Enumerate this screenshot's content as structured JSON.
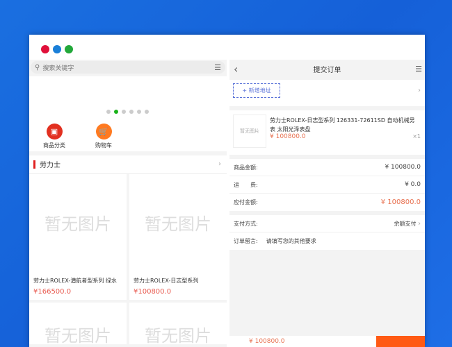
{
  "window": {
    "controls": [
      "close",
      "minimize",
      "maximize"
    ],
    "colors": {
      "close": "#e0103a",
      "minimize": "#1a7fd8",
      "maximize": "#22a83a"
    }
  },
  "left": {
    "search_placeholder": "搜索关键字",
    "banner_dots": 6,
    "banner_active": 1,
    "shortcuts": [
      {
        "label": "商品分类",
        "icon": "bag-icon",
        "color": "#e23020"
      },
      {
        "label": "购物车",
        "icon": "cart-icon",
        "color": "#ff7a20"
      }
    ],
    "section_title": "劳力士",
    "products": [
      {
        "placeholder": "暂无图片",
        "name": "劳力士ROLEX-潜航者型系列 绿水",
        "price": "¥166500.0"
      },
      {
        "placeholder": "暂无图片",
        "name": "劳力士ROLEX-日志型系列",
        "price": "¥100800.0"
      },
      {
        "placeholder": "暂无图片",
        "name": "",
        "price": ""
      },
      {
        "placeholder": "暂无图片",
        "name": "",
        "price": ""
      }
    ]
  },
  "right": {
    "title": "提交订单",
    "add_address": "+ 新增地址",
    "item": {
      "placeholder": "暂无图片",
      "name": "劳力士ROLEX-日志型系列 126331-72611SD 自动机械男表 太阳光泽表盘",
      "price": "¥ 100800.0",
      "qty": "×1"
    },
    "summary": [
      {
        "label": "商品金额:",
        "value": "¥ 100800.0"
      },
      {
        "label": "运　　费:",
        "value": "¥ 0.0"
      },
      {
        "label": "应付金额:",
        "value": "¥ 100800.0"
      }
    ],
    "payment_label": "支付方式:",
    "payment_value": "余额支付",
    "note_label": "订单留言:",
    "note_placeholder": "请填写您的其他要求",
    "footer_total": "¥ 100800.0"
  }
}
